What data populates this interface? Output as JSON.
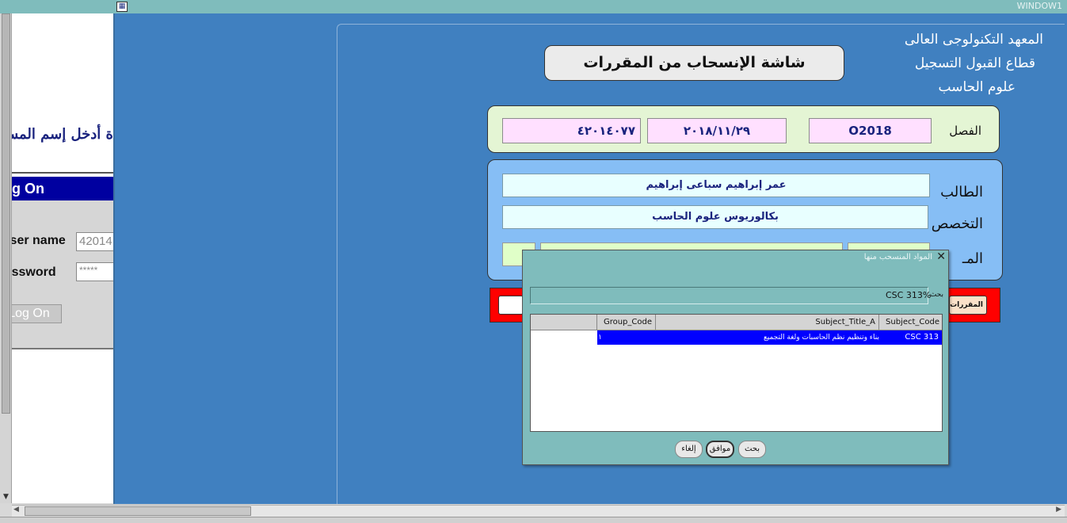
{
  "window": {
    "title": "WINDOW1",
    "icon": "app-form-icon"
  },
  "login": {
    "prompt": "ة أدخل إسم المس",
    "header": "Log On",
    "username_label": "User name",
    "username_value": "42014",
    "password_label": "Password",
    "password_value": "*****",
    "logon_button": "Log On"
  },
  "institute": {
    "line1": "المعهد التكنولوجى العالى",
    "line2": "قطاع القبول التسجيل",
    "line3": "علوم الحاسب"
  },
  "form": {
    "title": "شاشة الإنسحاب من المقررات",
    "semester": {
      "label": "الفصل",
      "code": "O2018",
      "date": "٢٠١٨/١١/٢٩",
      "student_id": "٤٢٠١٤٠٧٧"
    },
    "student": {
      "student_label": "الطالب",
      "student_name": "عمر إبراهيم سباعى إبراهيم",
      "major_label": "التخصص",
      "major_value": "بكالوريوس علوم الحاسب",
      "level_label": "المـ"
    },
    "red_bar_button": "المقررات"
  },
  "dialog": {
    "title": "المواد المنسحب منها",
    "close_icon": "close-icon",
    "search_label": "بحث",
    "search_value": "CSC 313%",
    "columns": [
      "Subject_Code",
      "Subject_Title_A",
      "Group_Code"
    ],
    "rows": [
      {
        "subject_code": "CSC 313",
        "subject_title": "بناء وتنظيم نظم الحاسبات ولغة التجميع",
        "group_code": "١"
      }
    ],
    "buttons": {
      "search": "بحث",
      "ok": "موافق",
      "cancel": "إلغاء"
    }
  },
  "colors": {
    "desktop": "#4080c0",
    "titlebar": "#7fbcbc",
    "selected_row": "#0000ff",
    "red_bar": "#ff0000"
  }
}
